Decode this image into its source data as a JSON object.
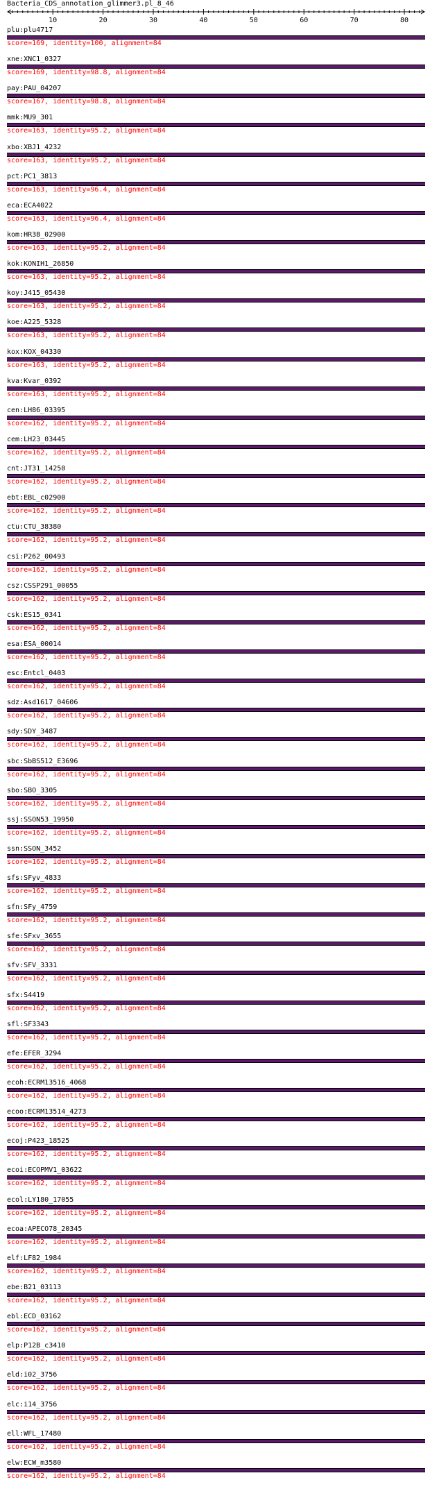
{
  "page": {
    "title": "Bacteria_CDS_annotation_glimmer3.pl_8_46"
  },
  "ruler": {
    "min": 1,
    "max": 84,
    "major_step": 10,
    "tick_labels": [
      "10",
      "20",
      "30",
      "40",
      "50",
      "60",
      "70",
      "80"
    ]
  },
  "colors": {
    "bar": "#5a1a6a",
    "bar_border": "#000000",
    "score_text": "#ff0000",
    "name_text": "#000000"
  },
  "hits": [
    {
      "name": "plu:plu4717",
      "score": "score=169, identity=100, alignment=84"
    },
    {
      "name": "xne:XNC1_0327",
      "score": "score=169, identity=98.8, alignment=84"
    },
    {
      "name": "pay:PAU_04207",
      "score": "score=167, identity=98.8, alignment=84"
    },
    {
      "name": "mmk:MU9_301",
      "score": "score=163, identity=95.2, alignment=84"
    },
    {
      "name": "xbo:XBJ1_4232",
      "score": "score=163, identity=95.2, alignment=84"
    },
    {
      "name": "pct:PC1_3813",
      "score": "score=163, identity=96.4, alignment=84"
    },
    {
      "name": "eca:ECA4022",
      "score": "score=163, identity=96.4, alignment=84"
    },
    {
      "name": "kom:HR38_02900",
      "score": "score=163, identity=95.2, alignment=84"
    },
    {
      "name": "kok:KONIH1_26850",
      "score": "score=163, identity=95.2, alignment=84"
    },
    {
      "name": "koy:J415_05430",
      "score": "score=163, identity=95.2, alignment=84"
    },
    {
      "name": "koe:A225_5328",
      "score": "score=163, identity=95.2, alignment=84"
    },
    {
      "name": "kox:KOX_04330",
      "score": "score=163, identity=95.2, alignment=84"
    },
    {
      "name": "kva:Kvar_0392",
      "score": "score=163, identity=95.2, alignment=84"
    },
    {
      "name": "cen:LH86_03395",
      "score": "score=162, identity=95.2, alignment=84"
    },
    {
      "name": "cem:LH23_03445",
      "score": "score=162, identity=95.2, alignment=84"
    },
    {
      "name": "cnt:JT31_14250",
      "score": "score=162, identity=95.2, alignment=84"
    },
    {
      "name": "ebt:EBL_c02900",
      "score": "score=162, identity=95.2, alignment=84"
    },
    {
      "name": "ctu:CTU_38380",
      "score": "score=162, identity=95.2, alignment=84"
    },
    {
      "name": "csi:P262_00493",
      "score": "score=162, identity=95.2, alignment=84"
    },
    {
      "name": "csz:CSSP291_00055",
      "score": "score=162, identity=95.2, alignment=84"
    },
    {
      "name": "csk:ES15_0341",
      "score": "score=162, identity=95.2, alignment=84"
    },
    {
      "name": "esa:ESA_00014",
      "score": "score=162, identity=95.2, alignment=84"
    },
    {
      "name": "esc:Entcl_0403",
      "score": "score=162, identity=95.2, alignment=84"
    },
    {
      "name": "sdz:Asd1617_04606",
      "score": "score=162, identity=95.2, alignment=84"
    },
    {
      "name": "sdy:SDY_3487",
      "score": "score=162, identity=95.2, alignment=84"
    },
    {
      "name": "sbc:SbBS512_E3696",
      "score": "score=162, identity=95.2, alignment=84"
    },
    {
      "name": "sbo:SBO_3305",
      "score": "score=162, identity=95.2, alignment=84"
    },
    {
      "name": "ssj:SSON53_19950",
      "score": "score=162, identity=95.2, alignment=84"
    },
    {
      "name": "ssn:SSON_3452",
      "score": "score=162, identity=95.2, alignment=84"
    },
    {
      "name": "sfs:SFyv_4833",
      "score": "score=162, identity=95.2, alignment=84"
    },
    {
      "name": "sfn:SFy_4759",
      "score": "score=162, identity=95.2, alignment=84"
    },
    {
      "name": "sfe:SFxv_3655",
      "score": "score=162, identity=95.2, alignment=84"
    },
    {
      "name": "sfv:SFV_3331",
      "score": "score=162, identity=95.2, alignment=84"
    },
    {
      "name": "sfx:S4419",
      "score": "score=162, identity=95.2, alignment=84"
    },
    {
      "name": "sfl:SF3343",
      "score": "score=162, identity=95.2, alignment=84"
    },
    {
      "name": "efe:EFER_3294",
      "score": "score=162, identity=95.2, alignment=84"
    },
    {
      "name": "ecoh:ECRM13516_4068",
      "score": "score=162, identity=95.2, alignment=84"
    },
    {
      "name": "ecoo:ECRM13514_4273",
      "score": "score=162, identity=95.2, alignment=84"
    },
    {
      "name": "ecoj:P423_18525",
      "score": "score=162, identity=95.2, alignment=84"
    },
    {
      "name": "ecoi:ECOPMV1_03622",
      "score": "score=162, identity=95.2, alignment=84"
    },
    {
      "name": "ecol:LY180_17055",
      "score": "score=162, identity=95.2, alignment=84"
    },
    {
      "name": "ecoa:APECO78_20345",
      "score": "score=162, identity=95.2, alignment=84"
    },
    {
      "name": "elf:LF82_1984",
      "score": "score=162, identity=95.2, alignment=84"
    },
    {
      "name": "ebe:B21_03113",
      "score": "score=162, identity=95.2, alignment=84"
    },
    {
      "name": "ebl:ECD_03162",
      "score": "score=162, identity=95.2, alignment=84"
    },
    {
      "name": "elp:P12B_c3410",
      "score": "score=162, identity=95.2, alignment=84"
    },
    {
      "name": "eld:i02_3756",
      "score": "score=162, identity=95.2, alignment=84"
    },
    {
      "name": "elc:i14_3756",
      "score": "score=162, identity=95.2, alignment=84"
    },
    {
      "name": "ell:WFL_17480",
      "score": "score=162, identity=95.2, alignment=84"
    },
    {
      "name": "elw:ECW_m3580",
      "score": "score=162, identity=95.2, alignment=84"
    }
  ]
}
